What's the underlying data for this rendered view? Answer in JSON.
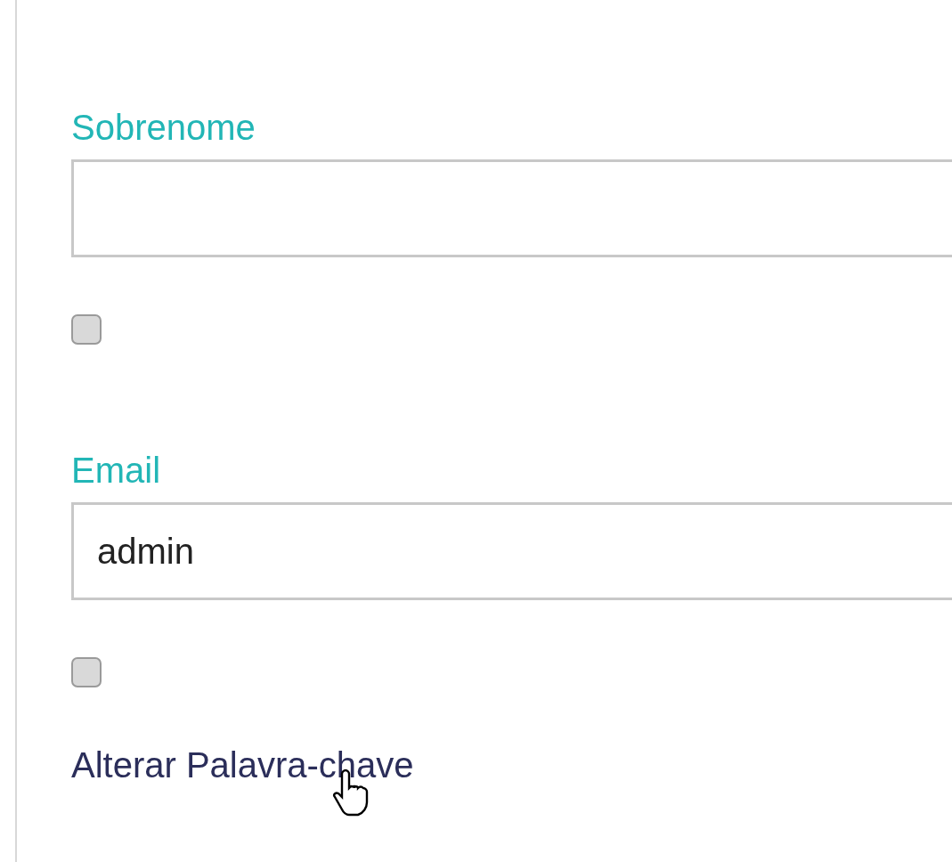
{
  "fields": [
    {
      "label": "Sobrenome",
      "checkbox": {
        "checked": false
      }
    },
    {
      "label": "Email",
      "value": "admin",
      "checkbox": {
        "checked": false
      }
    }
  ],
  "link": {
    "label": "Alterar Palavra-chave"
  }
}
